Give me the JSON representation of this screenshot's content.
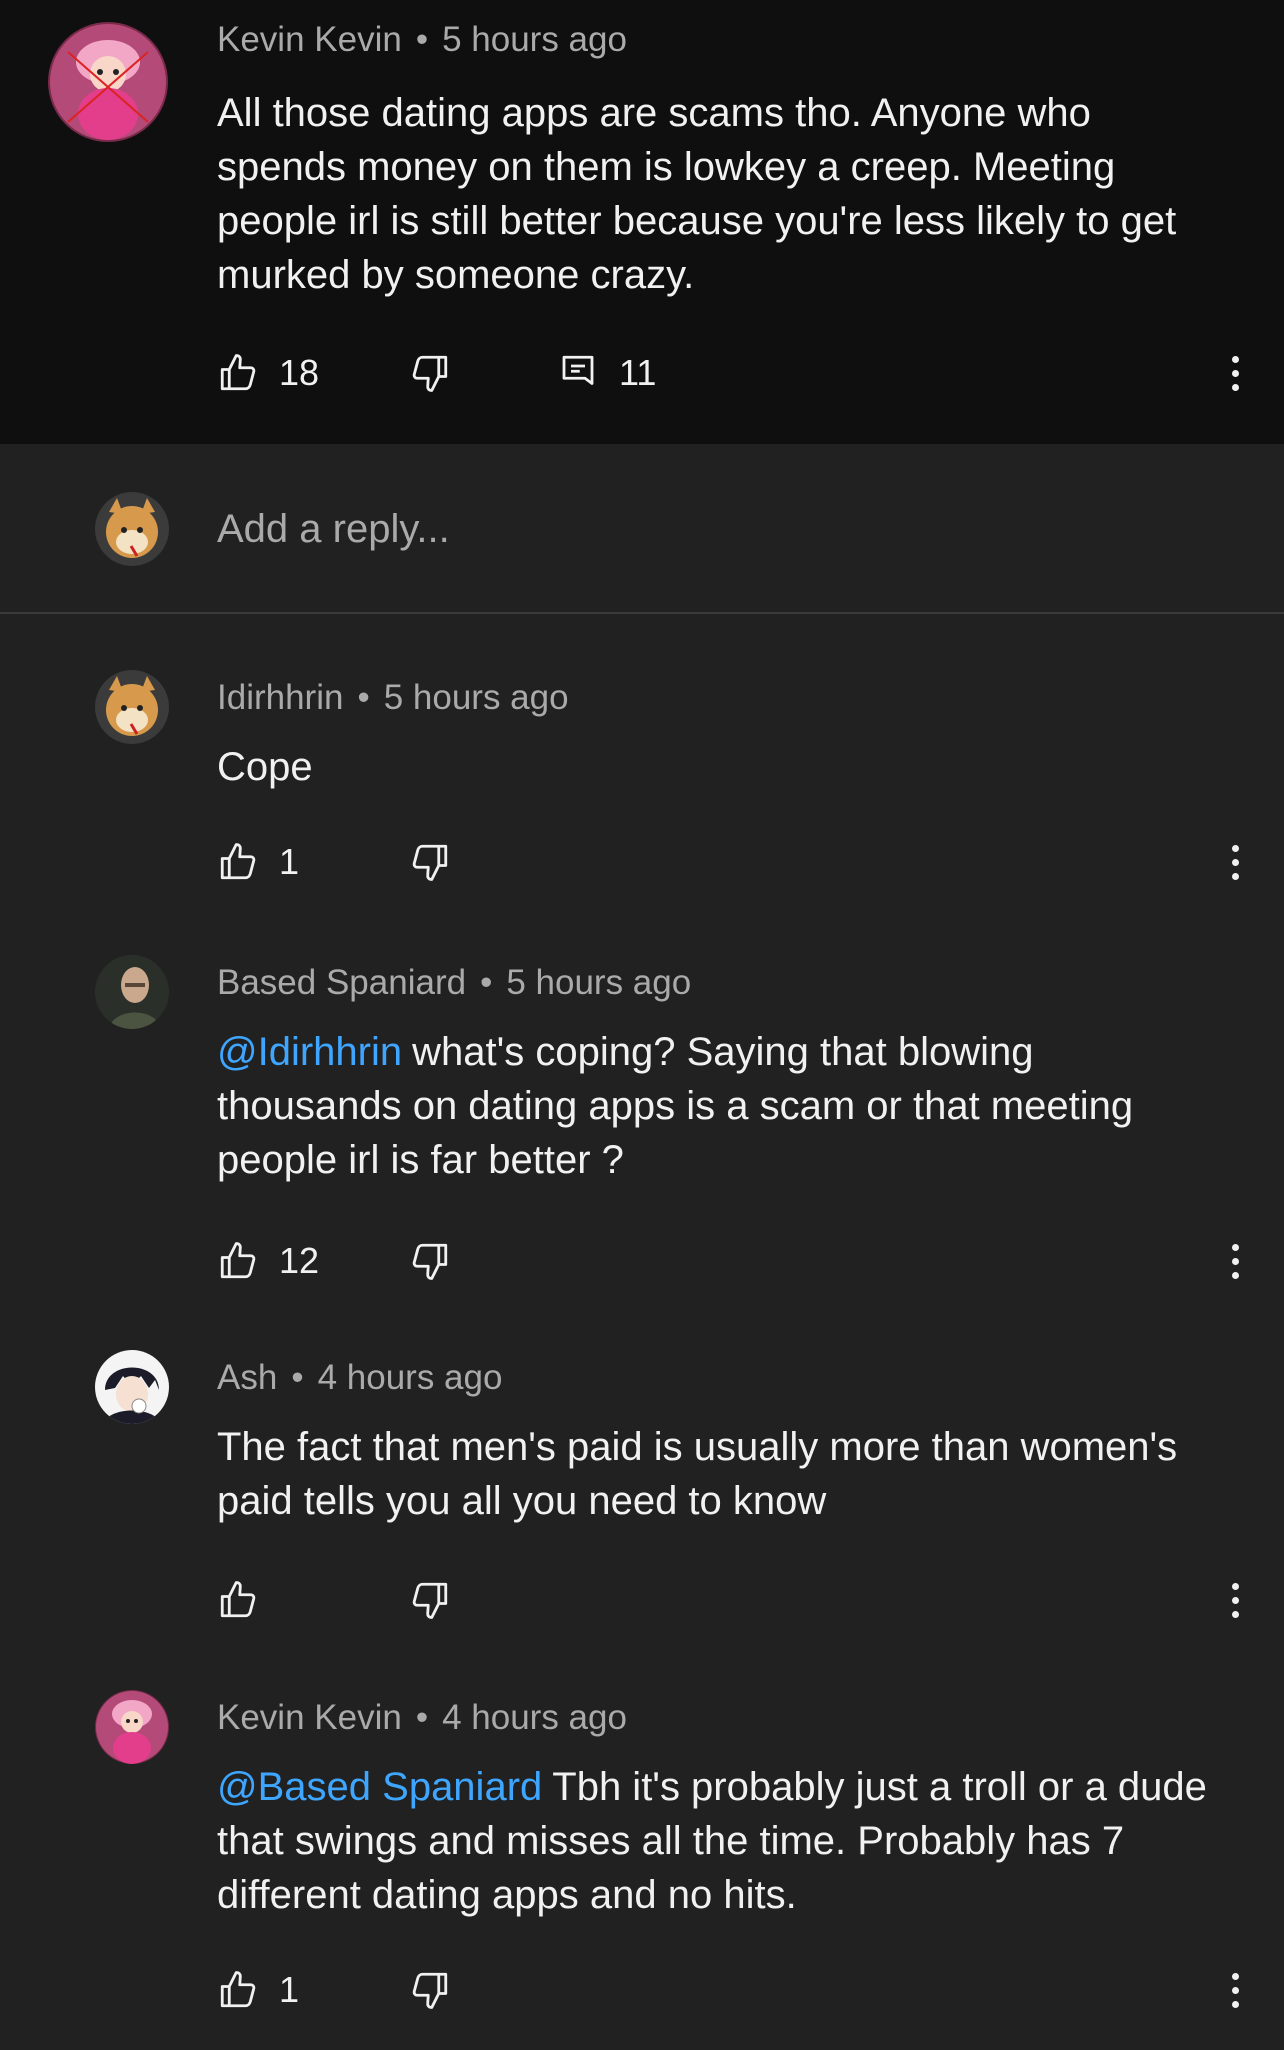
{
  "parent": {
    "author": "Kevin Kevin",
    "time": "5 hours ago",
    "text": "All those dating apps are scams tho. Anyone who spends money on them is lowkey a creep. Meeting people irl is still better because you're less likely to get murked by someone crazy.",
    "likes": "18",
    "reply_count": "11",
    "avatar_icon": "pink-anime-character-avatar"
  },
  "reply_box": {
    "placeholder": "Add a reply...",
    "avatar_icon": "shiba-dog-avatar"
  },
  "replies": [
    {
      "author": "Idirhhrin",
      "time": "5 hours ago",
      "mention": "",
      "text": "Cope",
      "likes": "1",
      "avatar_icon": "shiba-dog-avatar"
    },
    {
      "author": "Based Spaniard",
      "time": "5 hours ago",
      "mention": "@Idirhhrin",
      "text": "what's coping? Saying that blowing thousands on dating apps is a scam or that meeting people irl is far better ?",
      "likes": "12",
      "avatar_icon": "soldier-avatar"
    },
    {
      "author": "Ash",
      "time": "4 hours ago",
      "mention": "",
      "text": "The fact that men's paid is usually more than women's paid tells you all you need to know",
      "likes": "",
      "avatar_icon": "dark-haired-anime-avatar"
    },
    {
      "author": "Kevin Kevin",
      "time": "4 hours ago",
      "mention": "@Based Spaniard",
      "text": "Tbh it's probably just a troll or a dude that swings and misses all the time. Probably has 7 different dating apps and no hits.",
      "likes": "1",
      "avatar_icon": "pink-anime-character-avatar"
    }
  ],
  "meta_separator": "•",
  "colors": {
    "parent_bg": "#0f0f0f",
    "thread_bg": "#212121",
    "text": "#f1f1f1",
    "secondary_text": "#aaaaaa",
    "mention": "#3ea6ff"
  }
}
